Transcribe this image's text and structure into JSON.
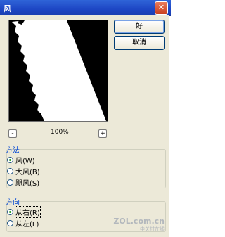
{
  "window": {
    "title": "风",
    "close_glyph": "✕"
  },
  "buttons": {
    "ok": "好",
    "cancel": "取消"
  },
  "zoom": {
    "minus": "-",
    "plus": "+",
    "level": "100%"
  },
  "method": {
    "title": "方法",
    "options": [
      {
        "label": "风(W)",
        "checked": true
      },
      {
        "label": "大风(B)",
        "checked": false
      },
      {
        "label": "飓风(S)",
        "checked": false
      }
    ]
  },
  "direction": {
    "title": "方向",
    "options": [
      {
        "label": "从右(R)",
        "checked": true
      },
      {
        "label": "从左(L)",
        "checked": false
      }
    ]
  },
  "watermark": {
    "line1": "ZOL.com.cn",
    "line2": "中关村在线"
  }
}
